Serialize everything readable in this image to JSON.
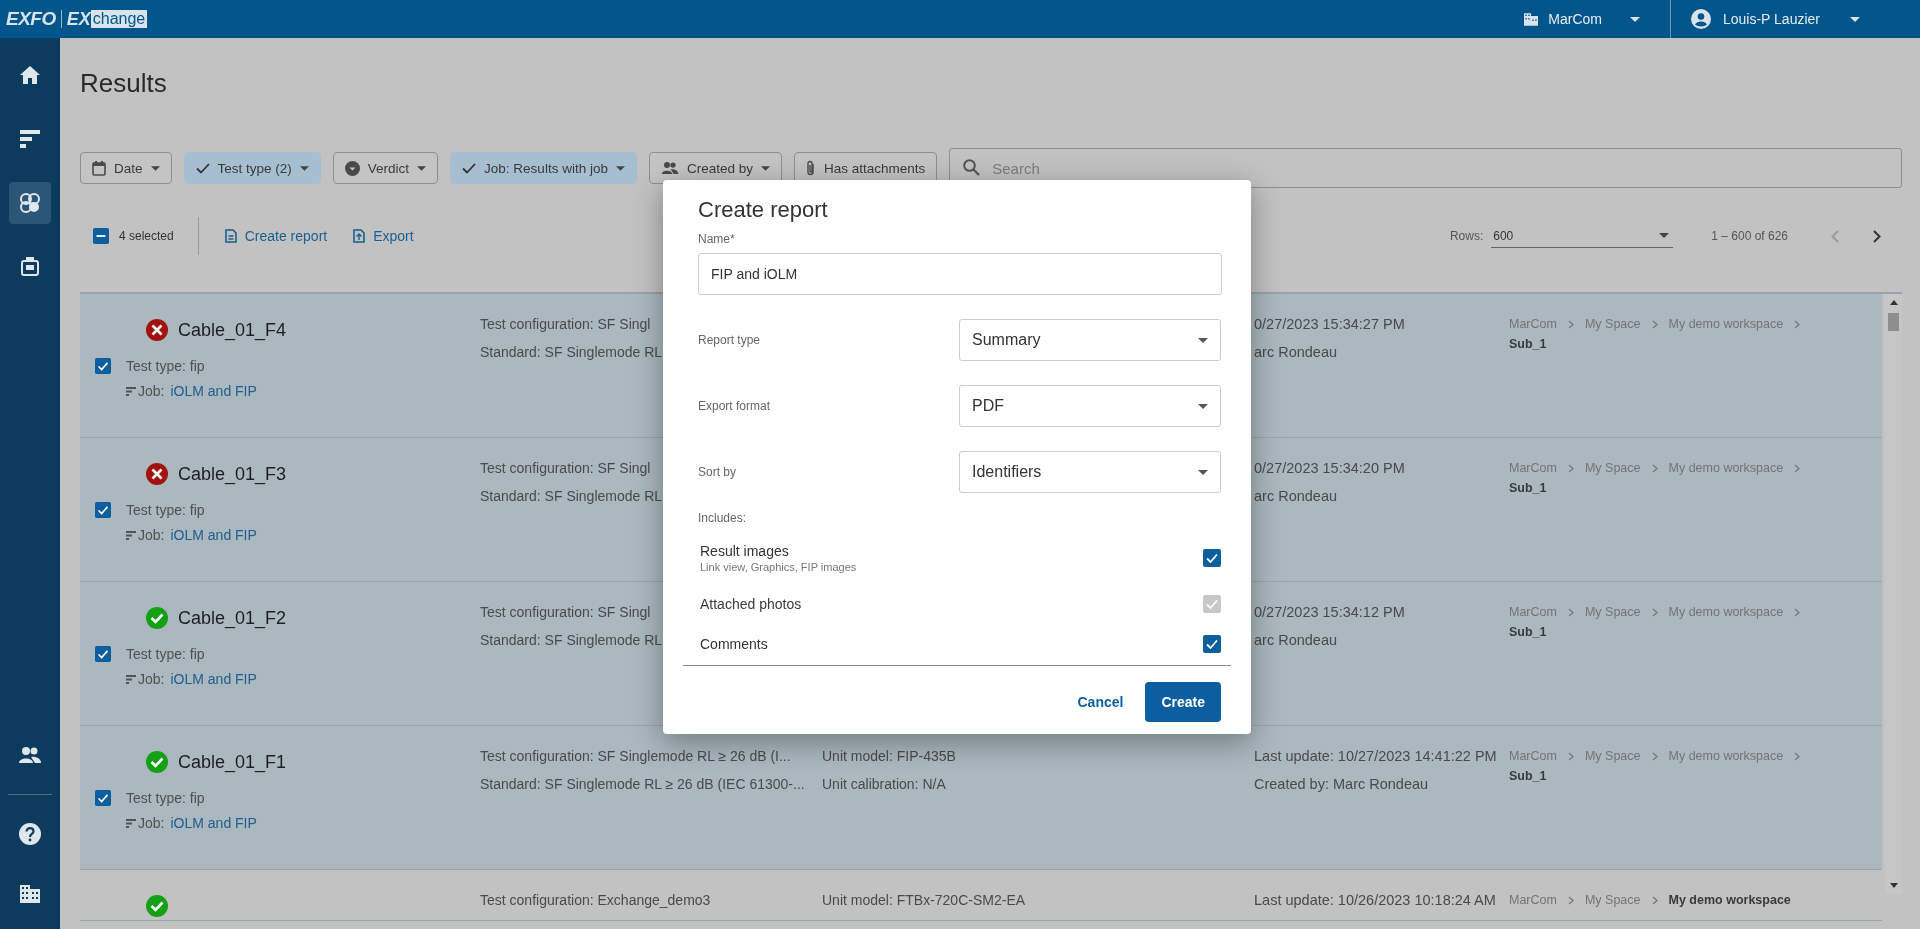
{
  "topbar": {
    "brand": "EXFO",
    "product_prefix": "EX",
    "product_suffix": "change",
    "organization": "MarCom",
    "user": "Louis-P Lauzier"
  },
  "sidebar": {
    "top_items": [
      {
        "selected": false
      },
      {
        "selected": false
      },
      {
        "selected": true
      },
      {
        "selected": false
      }
    ],
    "bottom_items": [
      {
        "selected": false
      },
      {
        "selected": false
      },
      {
        "selected": false
      }
    ]
  },
  "page_title": "Results",
  "filters": [
    {
      "label": "Date",
      "active": false,
      "kind": "dropdown"
    },
    {
      "label": "Test type (2)",
      "active": true,
      "kind": "dropdown"
    },
    {
      "label": "Verdict",
      "active": false,
      "kind": "dropdown"
    },
    {
      "label": "Job: Results with job",
      "active": true,
      "kind": "dropdown"
    },
    {
      "label": "Created by",
      "active": false,
      "kind": "dropdown"
    },
    {
      "label": "Has attachments",
      "active": false,
      "kind": "toggle"
    }
  ],
  "search": {
    "placeholder": "Search"
  },
  "actions": {
    "select_all": {
      "label": "4 selected",
      "indeterminate": true
    },
    "create_report": "Create report",
    "export": "Export"
  },
  "pagination": {
    "rows_label": "Rows:",
    "rows_value": "600",
    "range": "1 – 600 of 626",
    "prev_disabled": true,
    "next_disabled": false
  },
  "results": [
    {
      "selected": true,
      "checked": true,
      "passed": false,
      "name": "Cable_01_F4",
      "test_type": "Test type: fip",
      "job_label": "Job:",
      "job": "iOLM and FIP",
      "config": "Test configuration: SF Singl",
      "standard": "Standard: SF Singlemode RL",
      "last_update": "0/27/2023 15:34:27 PM",
      "created_by": "arc Rondeau",
      "breadcrumb": [
        "MarCom",
        "My Space",
        "My demo workspace",
        "Sub_1"
      ]
    },
    {
      "selected": true,
      "checked": true,
      "passed": false,
      "name": "Cable_01_F3",
      "test_type": "Test type: fip",
      "job_label": "Job:",
      "job": "iOLM and FIP",
      "config": "Test configuration: SF Singl",
      "standard": "Standard: SF Singlemode RL",
      "last_update": "0/27/2023 15:34:20 PM",
      "created_by": "arc Rondeau",
      "breadcrumb": [
        "MarCom",
        "My Space",
        "My demo workspace",
        "Sub_1"
      ]
    },
    {
      "selected": true,
      "checked": true,
      "passed": true,
      "name": "Cable_01_F2",
      "test_type": "Test type: fip",
      "job_label": "Job:",
      "job": "iOLM and FIP",
      "config": "Test configuration: SF Singl",
      "standard": "Standard: SF Singlemode RL",
      "last_update": "0/27/2023 15:34:12 PM",
      "created_by": "arc Rondeau",
      "breadcrumb": [
        "MarCom",
        "My Space",
        "My demo workspace",
        "Sub_1"
      ]
    },
    {
      "selected": true,
      "checked": true,
      "passed": true,
      "name": "Cable_01_F1",
      "test_type": "Test type: fip",
      "job_label": "Job:",
      "job": "iOLM and FIP",
      "config": "Test configuration: SF Singlemode RL ≥ 26 dB (I...",
      "standard": "Standard: SF Singlemode RL ≥ 26 dB (IEC 61300-...",
      "unit_model": "Unit model: FIP-435B",
      "unit_calibration": "Unit calibration: N/A",
      "last_update": "Last update: 10/27/2023 14:41:22 PM",
      "created_by": "Created by: Marc Rondeau",
      "breadcrumb": [
        "MarCom",
        "My Space",
        "My demo workspace",
        "Sub_1"
      ]
    },
    {
      "selected": false,
      "passed": true,
      "config": "Test configuration: Exchange_demo3",
      "unit_model": "Unit model: FTBx-720C-SM2-EA",
      "last_update": "Last update: 10/26/2023 10:18:24 AM",
      "breadcrumb": [
        "MarCom",
        "My Space",
        "My demo workspace"
      ]
    }
  ],
  "dialog": {
    "title": "Create report",
    "name_label": "Name*",
    "name_value": "FIP and iOLM",
    "selects": [
      {
        "label": "Report type",
        "value": "Summary"
      },
      {
        "label": "Export format",
        "value": "PDF"
      },
      {
        "label": "Sort by",
        "value": "Identifiers"
      }
    ],
    "includes_label": "Includes:",
    "includes": [
      {
        "label": "Result images",
        "hint": "Link view, Graphics, FIP images",
        "checked": true,
        "disabled": false
      },
      {
        "label": "Attached photos",
        "checked": true,
        "disabled": true
      },
      {
        "label": "Comments",
        "checked": true,
        "disabled": false
      }
    ],
    "cancel": "Cancel",
    "create": "Create"
  }
}
